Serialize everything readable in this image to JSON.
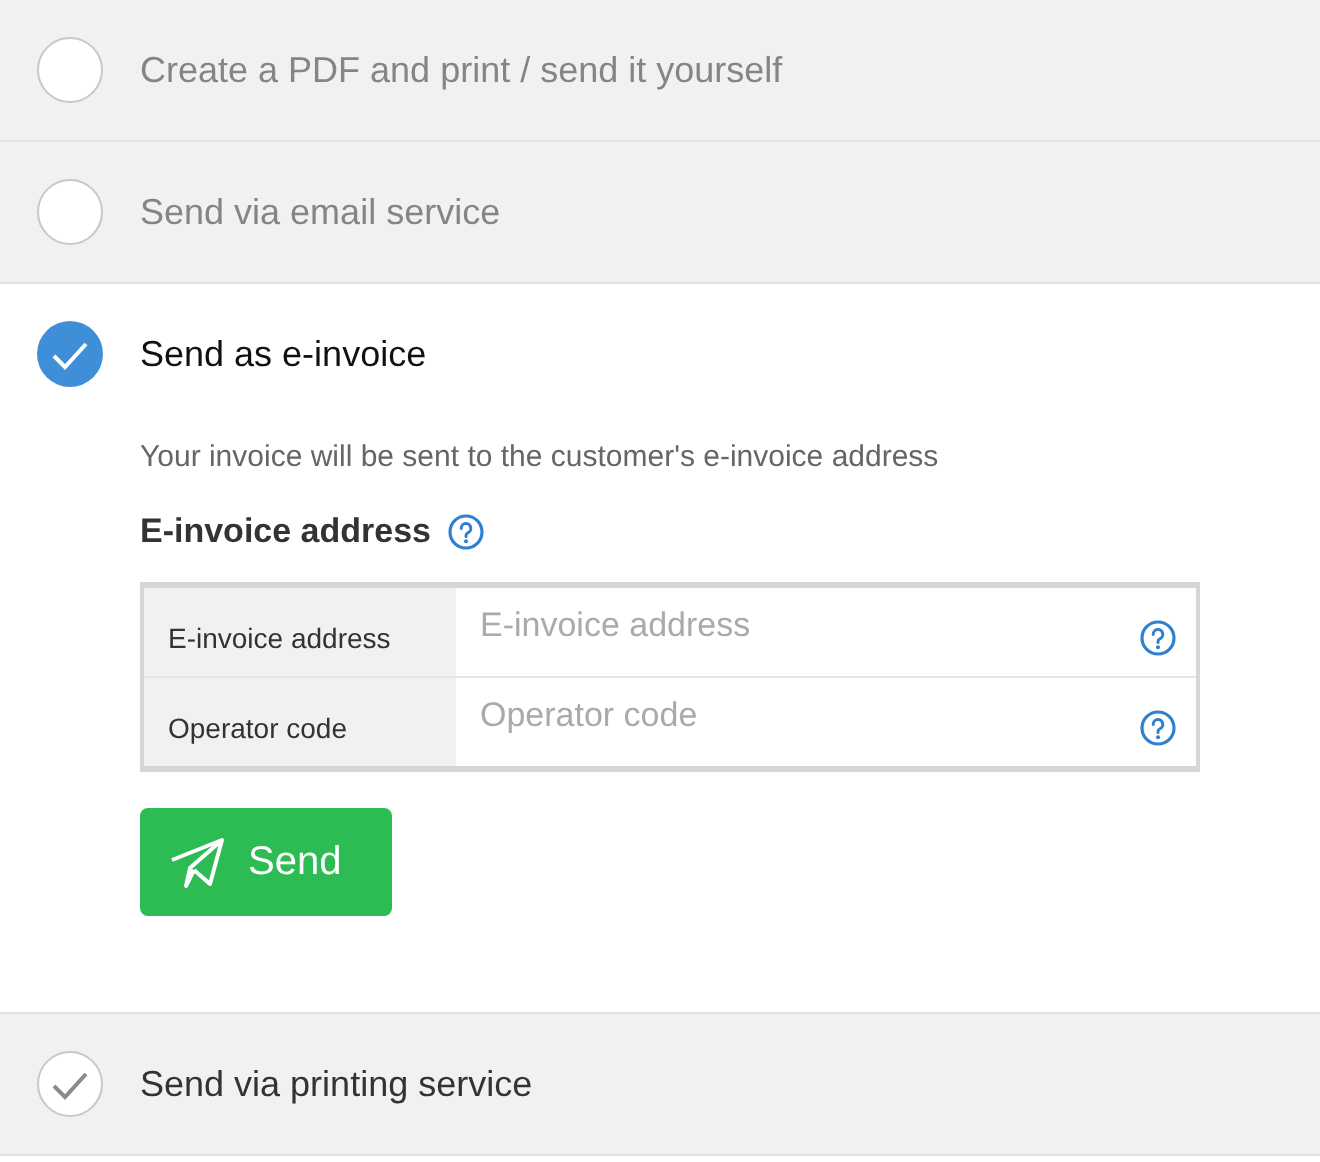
{
  "options": [
    {
      "label": "Create a PDF and print / send it yourself",
      "selected": false,
      "done": false
    },
    {
      "label": "Send via email service",
      "selected": false,
      "done": false
    },
    {
      "label": "Send as e-invoice",
      "selected": true,
      "done": false,
      "panel": {
        "description": "Your invoice will be sent to the customer's e-invoice address",
        "heading": "E-invoice address",
        "fields": [
          {
            "label": "E-invoice address",
            "placeholder": "E-invoice address"
          },
          {
            "label": "Operator code",
            "placeholder": "Operator code"
          }
        ],
        "button": "Send"
      }
    },
    {
      "label": "Send via printing service",
      "selected": false,
      "done": true
    }
  ]
}
